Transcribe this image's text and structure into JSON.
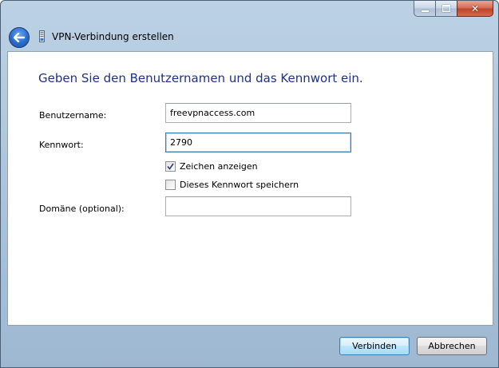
{
  "window": {
    "title": "VPN-Verbindung erstellen"
  },
  "caption": {
    "close_glyph": "✕"
  },
  "heading": "Geben Sie den Benutzernamen und das Kennwort ein.",
  "form": {
    "username_label": "Benutzername:",
    "username_value": "freevpnaccess.com",
    "password_label": "Kennwort:",
    "password_value": "2790",
    "show_chars_label": "Zeichen anzeigen",
    "show_chars_checked": true,
    "save_password_label": "Dieses Kennwort speichern",
    "save_password_checked": false,
    "domain_label": "Domäne (optional):",
    "domain_value": ""
  },
  "buttons": {
    "connect_label": "Verbinden",
    "cancel_label": "Abbrechen"
  },
  "icons": {
    "back": "back-arrow-icon",
    "title": "vpn-network-icon",
    "check": "checkmark-icon"
  },
  "colors": {
    "heading": "#1e3287",
    "focus_border": "#3d7bad",
    "close_button": "#c0442a"
  }
}
